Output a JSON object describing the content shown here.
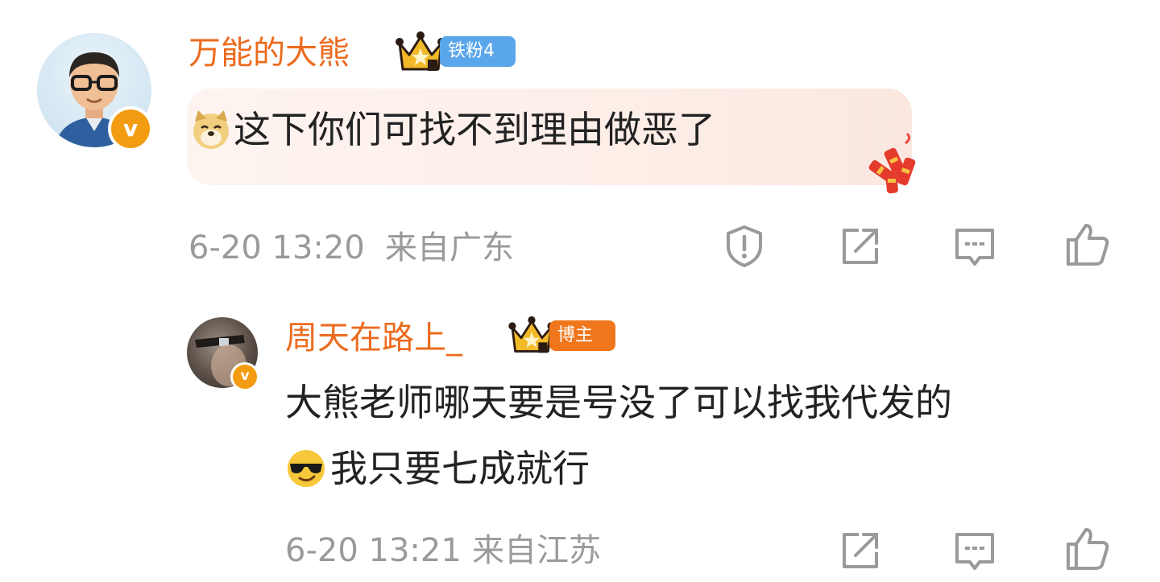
{
  "comment": {
    "username": "万能的大熊",
    "fan_tag": "铁粉4",
    "text": "这下你们可找不到理由做恶了",
    "time": "6-20 13:20",
    "location": "来自广东",
    "actions": [
      "report-icon",
      "share-icon",
      "comment-icon",
      "like-icon"
    ]
  },
  "reply": {
    "username": "周天在路上_",
    "host_tag": "博主",
    "text_line1": "大熊老师哪天要是号没了可以找我代发的",
    "text_line2": "我只要七成就行",
    "time": "6-20 13:21",
    "location": "来自江苏",
    "actions": [
      "share-icon",
      "comment-icon",
      "like-icon"
    ]
  },
  "colors": {
    "username": "#ec6b1e",
    "fan_tag": "#5aa6ea",
    "host_tag": "#f0761c",
    "meta": "#9a9a9a",
    "verified_badge": "#f39c12"
  }
}
